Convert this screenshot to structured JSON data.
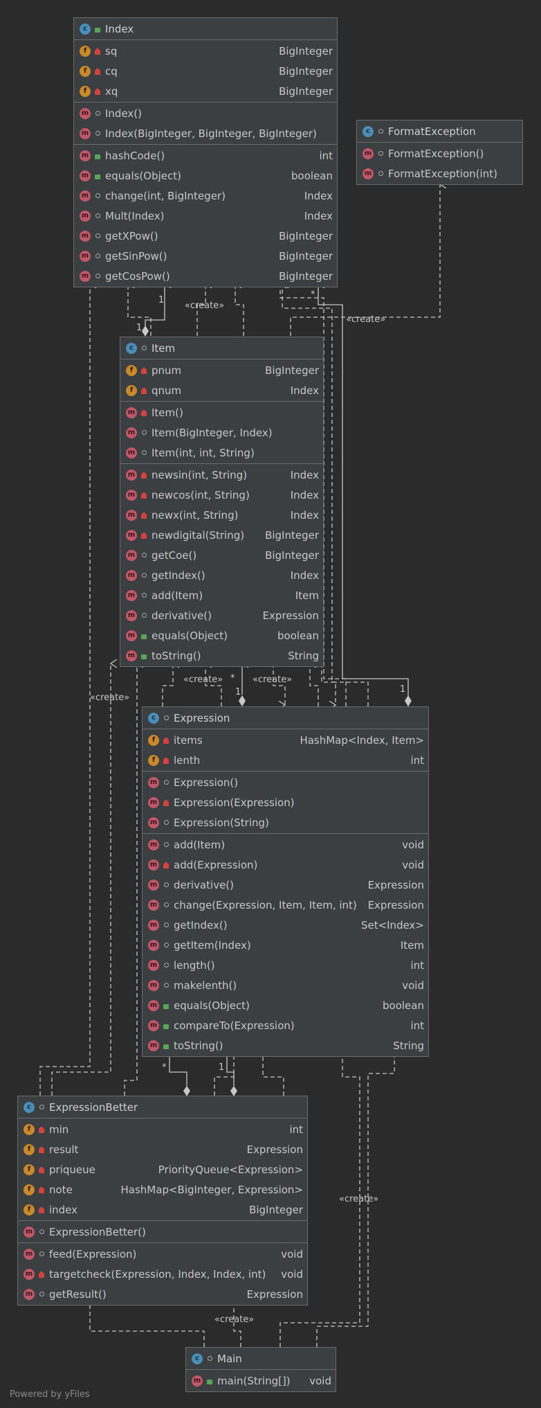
{
  "classes": [
    {
      "key": "index",
      "name": "Index",
      "fields": [
        {
          "vis": "lock-red",
          "name": "sq",
          "type": "BigInteger"
        },
        {
          "vis": "lock-red",
          "name": "cq",
          "type": "BigInteger"
        },
        {
          "vis": "lock-red",
          "name": "xq",
          "type": "BigInteger"
        }
      ],
      "constructors": [
        {
          "vis": "dot",
          "name": "Index()",
          "type": ""
        },
        {
          "vis": "dot",
          "name": "Index(BigInteger, BigInteger, BigInteger)",
          "type": ""
        }
      ],
      "methods": [
        {
          "vis": "lock-green",
          "name": "hashCode()",
          "type": "int"
        },
        {
          "vis": "lock-green",
          "name": "equals(Object)",
          "type": "boolean"
        },
        {
          "vis": "dot",
          "name": "change(int, BigInteger)",
          "type": "Index"
        },
        {
          "vis": "dot",
          "name": "Mult(Index)",
          "type": "Index"
        },
        {
          "vis": "dot",
          "name": "getXPow()",
          "type": "BigInteger"
        },
        {
          "vis": "dot",
          "name": "getSinPow()",
          "type": "BigInteger"
        },
        {
          "vis": "dot",
          "name": "getCosPow()",
          "type": "BigInteger"
        }
      ]
    },
    {
      "key": "formatexception",
      "name": "FormatException",
      "fields": [],
      "constructors": [
        {
          "vis": "dot",
          "name": "FormatException()",
          "type": ""
        },
        {
          "vis": "dot",
          "name": "FormatException(int)",
          "type": ""
        }
      ],
      "methods": []
    },
    {
      "key": "item",
      "name": "Item",
      "fields": [
        {
          "vis": "lock-red",
          "name": "pnum",
          "type": "BigInteger"
        },
        {
          "vis": "lock-red",
          "name": "qnum",
          "type": "Index"
        }
      ],
      "constructors": [
        {
          "vis": "lock-red",
          "name": "Item()",
          "type": ""
        },
        {
          "vis": "dot",
          "name": "Item(BigInteger, Index)",
          "type": ""
        },
        {
          "vis": "dot",
          "name": "Item(int, int, String)",
          "type": ""
        }
      ],
      "methods": [
        {
          "vis": "lock-red",
          "name": "newsin(int, String)",
          "type": "Index"
        },
        {
          "vis": "lock-red",
          "name": "newcos(int, String)",
          "type": "Index"
        },
        {
          "vis": "lock-red",
          "name": "newx(int, String)",
          "type": "Index"
        },
        {
          "vis": "lock-red",
          "name": "newdigital(String)",
          "type": "BigInteger"
        },
        {
          "vis": "dot",
          "name": "getCoe()",
          "type": "BigInteger"
        },
        {
          "vis": "dot",
          "name": "getIndex()",
          "type": "Index"
        },
        {
          "vis": "dot",
          "name": "add(Item)",
          "type": "Item"
        },
        {
          "vis": "dot",
          "name": "derivative()",
          "type": "Expression"
        },
        {
          "vis": "lock-green",
          "name": "equals(Object)",
          "type": "boolean"
        },
        {
          "vis": "lock-green",
          "name": "toString()",
          "type": "String"
        }
      ]
    },
    {
      "key": "expression",
      "name": "Expression",
      "fields": [
        {
          "vis": "lock-red",
          "name": "items",
          "type": "HashMap<Index, Item>"
        },
        {
          "vis": "lock-red",
          "name": "lenth",
          "type": "int"
        }
      ],
      "constructors": [
        {
          "vis": "dot",
          "name": "Expression()",
          "type": ""
        },
        {
          "vis": "lock-red",
          "name": "Expression(Expression)",
          "type": ""
        },
        {
          "vis": "dot",
          "name": "Expression(String)",
          "type": ""
        }
      ],
      "methods": [
        {
          "vis": "dot",
          "name": "add(Item)",
          "type": "void"
        },
        {
          "vis": "lock-red",
          "name": "add(Expression)",
          "type": "void"
        },
        {
          "vis": "dot",
          "name": "derivative()",
          "type": "Expression"
        },
        {
          "vis": "dot",
          "name": "change(Expression, Item, Item, int)",
          "type": "Expression"
        },
        {
          "vis": "dot",
          "name": "getIndex()",
          "type": "Set<Index>"
        },
        {
          "vis": "dot",
          "name": "getItem(Index)",
          "type": "Item"
        },
        {
          "vis": "dot",
          "name": "length()",
          "type": "int"
        },
        {
          "vis": "dot",
          "name": "makelenth()",
          "type": "void"
        },
        {
          "vis": "lock-green",
          "name": "equals(Object)",
          "type": "boolean"
        },
        {
          "vis": "lock-green",
          "name": "compareTo(Expression)",
          "type": "int"
        },
        {
          "vis": "lock-green",
          "name": "toString()",
          "type": "String"
        }
      ]
    },
    {
      "key": "expressionbetter",
      "name": "ExpressionBetter",
      "fields": [
        {
          "vis": "lock-red",
          "name": "min",
          "type": "int"
        },
        {
          "vis": "lock-red",
          "name": "result",
          "type": "Expression"
        },
        {
          "vis": "lock-red",
          "name": "priqueue",
          "type": "PriorityQueue<Expression>"
        },
        {
          "vis": "lock-red",
          "name": "note",
          "type": "HashMap<BigInteger, Expression>"
        },
        {
          "vis": "lock-red",
          "name": "index",
          "type": "BigInteger"
        }
      ],
      "constructors": [
        {
          "vis": "dot",
          "name": "ExpressionBetter()",
          "type": ""
        }
      ],
      "methods": [
        {
          "vis": "dot",
          "name": "feed(Expression)",
          "type": "void"
        },
        {
          "vis": "lock-red",
          "name": "targetcheck(Expression, Index, Index, int)",
          "type": "void"
        },
        {
          "vis": "dot",
          "name": "getResult()",
          "type": "Expression"
        }
      ]
    },
    {
      "key": "main",
      "name": "Main",
      "fields": [],
      "constructors": [],
      "methods": [
        {
          "vis": "lock-green",
          "name": "main(String[])",
          "type": "void"
        }
      ]
    }
  ],
  "labels": {
    "create": "«create»",
    "one": "1",
    "many": "*"
  },
  "footer": "Powered by yFiles"
}
